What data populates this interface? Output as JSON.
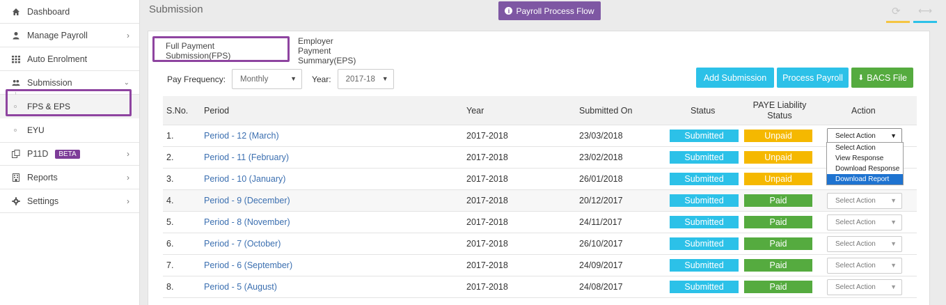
{
  "sidebar": {
    "items": [
      {
        "label": "Dashboard",
        "icon": "home-icon"
      },
      {
        "label": "Manage Payroll",
        "icon": "user-icon"
      },
      {
        "label": "Auto Enrolment",
        "icon": "grid-icon"
      },
      {
        "label": "Submission",
        "icon": "users-icon"
      },
      {
        "label": "P11D",
        "icon": "copy-icon",
        "badge": "BETA"
      },
      {
        "label": "Reports",
        "icon": "report-icon"
      },
      {
        "label": "Settings",
        "icon": "gear-icon"
      }
    ],
    "sub_items": [
      {
        "label": "FPS & EPS"
      },
      {
        "label": "EYU"
      }
    ]
  },
  "header": {
    "title": "Submission",
    "flow_button": "Payroll Process Flow"
  },
  "tabs": [
    {
      "label": "Full Payment Submission(FPS)"
    },
    {
      "label": "Employer Payment Summary(EPS)"
    }
  ],
  "filters": {
    "pay_frequency_label": "Pay Frequency:",
    "pay_frequency_value": "Monthly",
    "year_label": "Year:",
    "year_value": "2017-18"
  },
  "buttons": {
    "add": "Add Submission",
    "process": "Process Payroll",
    "bacs": "BACS File"
  },
  "table": {
    "headers": {
      "sno": "S.No.",
      "period": "Period",
      "year": "Year",
      "submitted_on": "Submitted On",
      "status": "Status",
      "paye_line1": "PAYE Liability",
      "paye_line2": "Status",
      "action": "Action"
    },
    "rows": [
      {
        "sno": "1.",
        "period": "Period - 12 (March)",
        "year": "2017-2018",
        "submitted_on": "23/03/2018",
        "status": "Submitted",
        "paye": "Unpaid",
        "action": "Select Action"
      },
      {
        "sno": "2.",
        "period": "Period - 11 (February)",
        "year": "2017-2018",
        "submitted_on": "23/02/2018",
        "status": "Submitted",
        "paye": "Unpaid",
        "action": "Select Action"
      },
      {
        "sno": "3.",
        "period": "Period - 10 (January)",
        "year": "2017-2018",
        "submitted_on": "26/01/2018",
        "status": "Submitted",
        "paye": "Unpaid",
        "action": "Select Action"
      },
      {
        "sno": "4.",
        "period": "Period - 9 (December)",
        "year": "2017-2018",
        "submitted_on": "20/12/2017",
        "status": "Submitted",
        "paye": "Paid",
        "action": "Select Action"
      },
      {
        "sno": "5.",
        "period": "Period - 8 (November)",
        "year": "2017-2018",
        "submitted_on": "24/11/2017",
        "status": "Submitted",
        "paye": "Paid",
        "action": "Select Action"
      },
      {
        "sno": "6.",
        "period": "Period - 7 (October)",
        "year": "2017-2018",
        "submitted_on": "26/10/2017",
        "status": "Submitted",
        "paye": "Paid",
        "action": "Select Action"
      },
      {
        "sno": "7.",
        "period": "Period - 6 (September)",
        "year": "2017-2018",
        "submitted_on": "24/09/2017",
        "status": "Submitted",
        "paye": "Paid",
        "action": "Select Action"
      },
      {
        "sno": "8.",
        "period": "Period - 5 (August)",
        "year": "2017-2018",
        "submitted_on": "24/08/2017",
        "status": "Submitted",
        "paye": "Paid",
        "action": "Select Action"
      }
    ],
    "action_options": [
      "Select Action",
      "View Response",
      "Download Response",
      "Download Report"
    ]
  },
  "colors": {
    "purple": "#7e57a3",
    "cyan": "#2cc1e8",
    "green": "#55ab3f",
    "unpaid": "#f5b800",
    "paid": "#55ab3f"
  }
}
